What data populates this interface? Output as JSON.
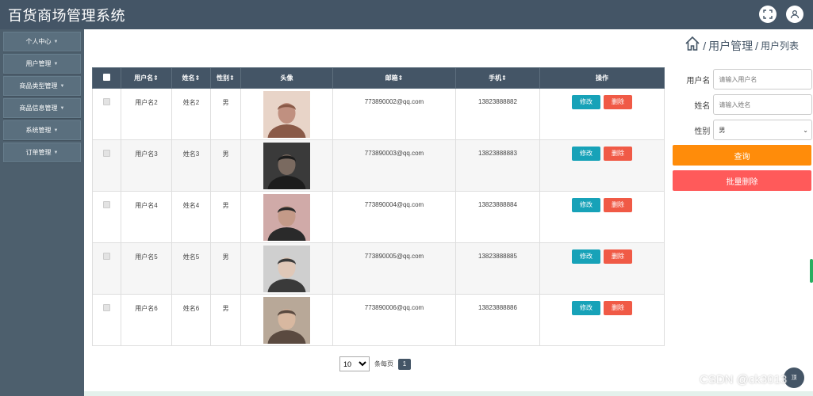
{
  "app": {
    "title": "百货商场管理系统"
  },
  "sidebar": {
    "items": [
      {
        "label": "个人中心"
      },
      {
        "label": "用户管理"
      },
      {
        "label": "商品类型管理"
      },
      {
        "label": "商品信息管理"
      },
      {
        "label": "系统管理"
      },
      {
        "label": "订单管理"
      }
    ]
  },
  "breadcrumb": {
    "separator": "/",
    "section": "用户管理",
    "page": "用户列表"
  },
  "table": {
    "columns": [
      "用户名",
      "姓名",
      "性别",
      "头像",
      "邮箱",
      "手机",
      "操作"
    ],
    "sortable_marker": "⇕",
    "rows": [
      {
        "username": "用户名2",
        "name": "姓名2",
        "gender": "男",
        "email": "773890002@qq.com",
        "phone": "13823888882"
      },
      {
        "username": "用户名3",
        "name": "姓名3",
        "gender": "男",
        "email": "773890003@qq.com",
        "phone": "13823888883"
      },
      {
        "username": "用户名4",
        "name": "姓名4",
        "gender": "男",
        "email": "773890004@qq.com",
        "phone": "13823888884"
      },
      {
        "username": "用户名5",
        "name": "姓名5",
        "gender": "男",
        "email": "773890005@qq.com",
        "phone": "13823888885"
      },
      {
        "username": "用户名6",
        "name": "姓名6",
        "gender": "男",
        "email": "773890006@qq.com",
        "phone": "13823888886"
      }
    ],
    "edit_label": "修改",
    "delete_label": "删除"
  },
  "pagination": {
    "page_size": "10",
    "per_page_label": "条每页",
    "current_page": "1"
  },
  "search": {
    "username_label": "用户名",
    "username_placeholder": "请输入用户名",
    "name_label": "姓名",
    "name_placeholder": "请输入姓名",
    "gender_label": "性别",
    "gender_value": "男",
    "query_label": "查询",
    "batch_delete_label": "批量删除"
  },
  "float_button": {
    "label": "顶"
  },
  "watermark": "CSDN @ck3013",
  "colors": {
    "header": "#445566",
    "sidebar": "#4d5f6d",
    "edit": "#17a2b8",
    "delete": "#f05a46",
    "query": "#ff8c0a",
    "batch_delete": "#ff5a5a"
  }
}
